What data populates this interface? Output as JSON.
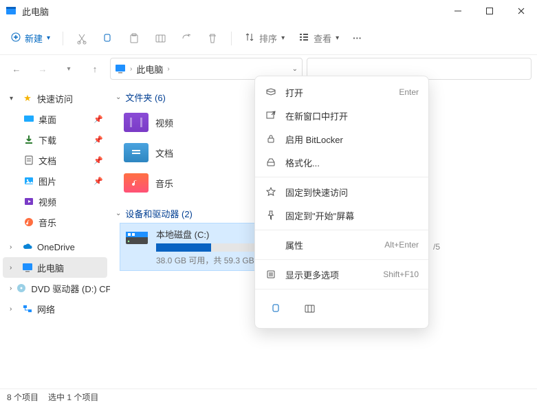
{
  "title": "此电脑",
  "toolbar": {
    "new": "新建",
    "sort": "排序",
    "view": "查看"
  },
  "breadcrumb": {
    "root": "此电脑"
  },
  "sidebar": {
    "quick": {
      "label": "快速访问",
      "items": [
        {
          "label": "桌面"
        },
        {
          "label": "下载"
        },
        {
          "label": "文档"
        },
        {
          "label": "图片"
        },
        {
          "label": "视频"
        },
        {
          "label": "音乐"
        }
      ]
    },
    "onedrive": "OneDrive",
    "thispc": "此电脑",
    "dvd": "DVD 驱动器 (D:) CP",
    "network": "网络"
  },
  "sections": {
    "folders": {
      "title": "文件夹 (6)",
      "items": [
        {
          "label": "视频"
        },
        {
          "label": "文档"
        },
        {
          "label": "音乐"
        }
      ]
    },
    "drives": {
      "title": "设备和驱动器 (2)",
      "items": [
        {
          "label": "本地磁盘 (C:)",
          "free_text": "38.0 GB 可用，共 59.3 GB",
          "fill_pct": 36
        }
      ]
    }
  },
  "drive_trail": "/5",
  "context_menu": {
    "items": [
      {
        "icon": "open",
        "label": "打开",
        "shortcut": "Enter"
      },
      {
        "icon": "newwin",
        "label": "在新窗口中打开",
        "shortcut": ""
      },
      {
        "icon": "lock",
        "label": "启用 BitLocker",
        "shortcut": ""
      },
      {
        "icon": "format",
        "label": "格式化...",
        "shortcut": ""
      },
      {
        "icon": "star",
        "label": "固定到快速访问",
        "shortcut": ""
      },
      {
        "icon": "pin",
        "label": "固定到\"开始\"屏幕",
        "shortcut": ""
      },
      {
        "icon": "props",
        "label": "属性",
        "shortcut": "Alt+Enter"
      },
      {
        "icon": "more",
        "label": "显示更多选项",
        "shortcut": "Shift+F10"
      }
    ]
  },
  "status": {
    "items": "8 个项目",
    "selected": "选中 1 个项目"
  }
}
